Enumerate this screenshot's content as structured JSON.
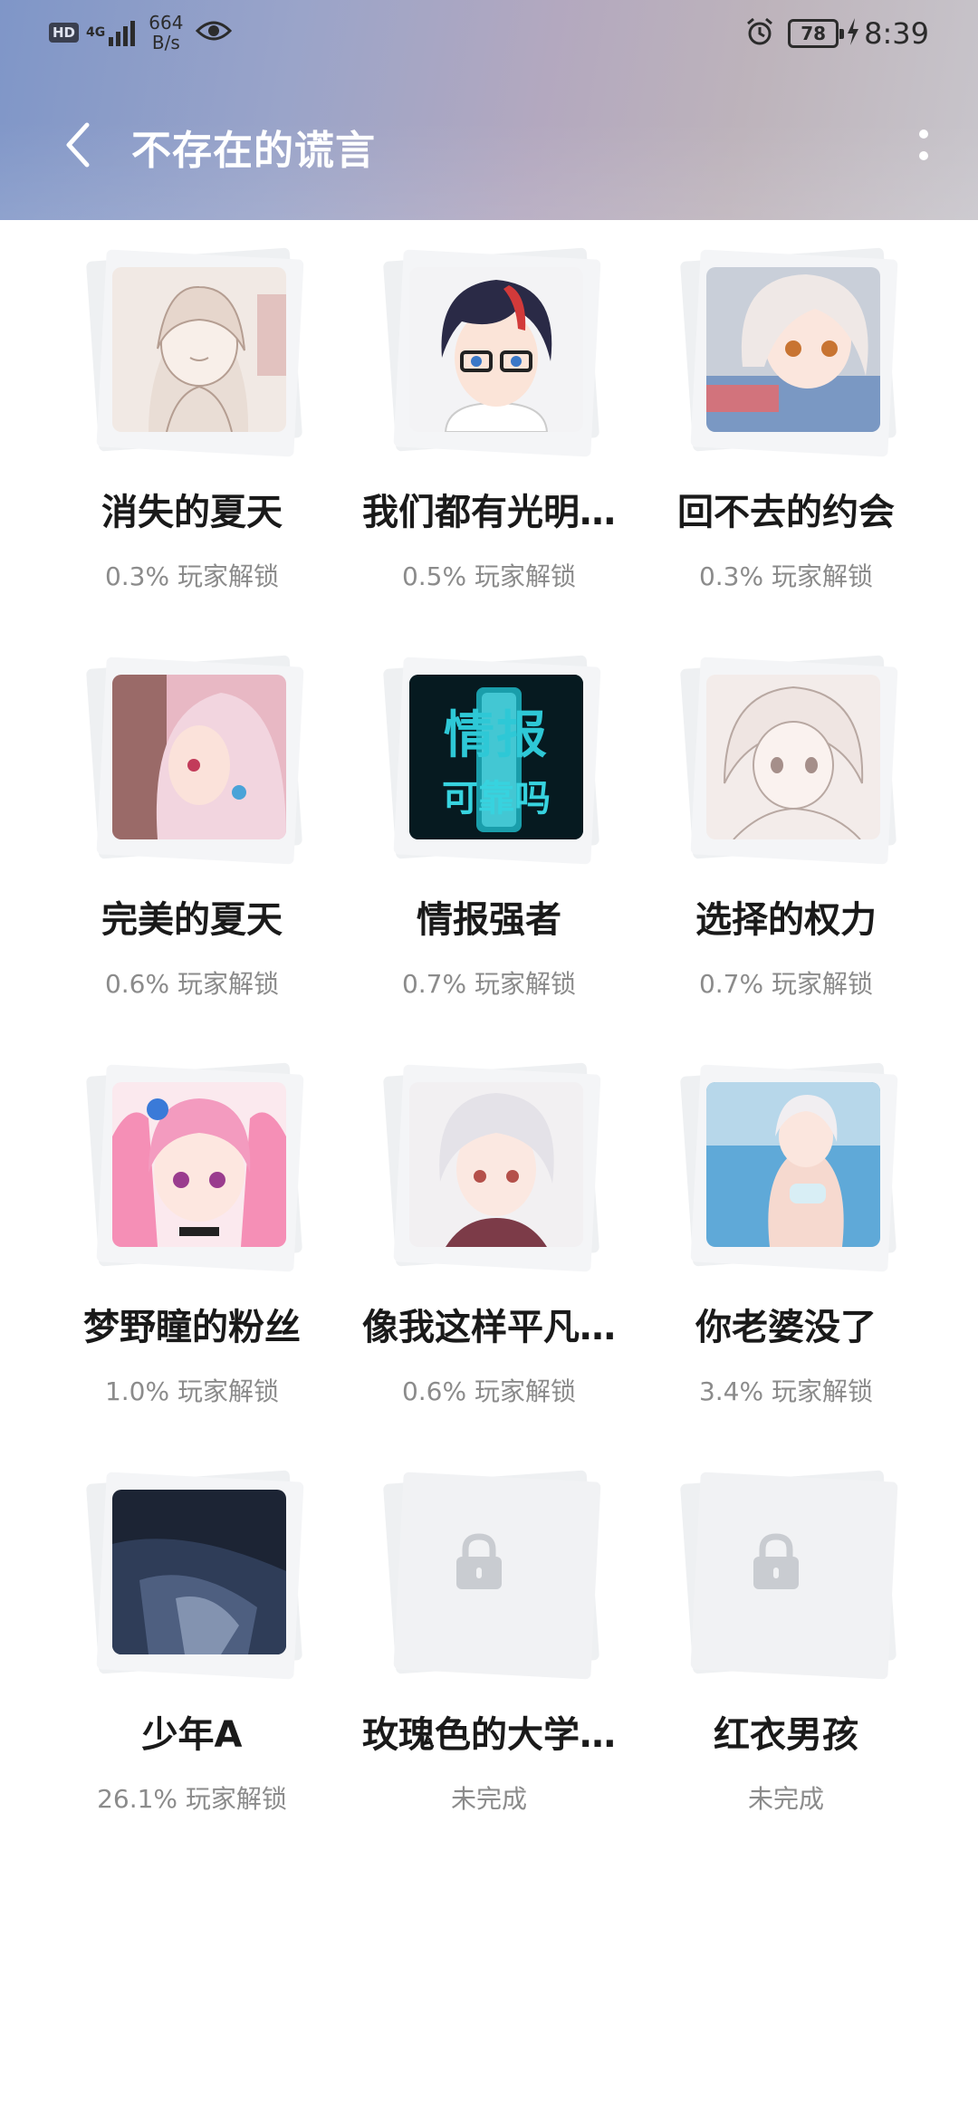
{
  "status_bar": {
    "hd": "HD",
    "network": "4G",
    "speed_value": "664",
    "speed_unit": "B/s",
    "battery": "78",
    "time": "8:39"
  },
  "header": {
    "title": "不存在的谎言"
  },
  "achievements": [
    {
      "title": "消失的夏天",
      "sub": "0.3% 玩家解锁",
      "locked": false,
      "art": "sketch-girl"
    },
    {
      "title": "我们都有光明…",
      "sub": "0.5% 玩家解锁",
      "locked": false,
      "art": "boy-glasses"
    },
    {
      "title": "回不去的约会",
      "sub": "0.3% 玩家解锁",
      "locked": false,
      "art": "white-hair-girl"
    },
    {
      "title": "完美的夏天",
      "sub": "0.6% 玩家解锁",
      "locked": false,
      "art": "pink-profile"
    },
    {
      "title": "情报强者",
      "sub": "0.7% 玩家解锁",
      "locked": false,
      "art": "info-card"
    },
    {
      "title": "选择的权力",
      "sub": "0.7% 玩家解锁",
      "locked": false,
      "art": "sketch-girl-2"
    },
    {
      "title": "梦野瞳的粉丝",
      "sub": "1.0% 玩家解锁",
      "locked": false,
      "art": "pink-twintail"
    },
    {
      "title": "像我这样平凡…",
      "sub": "0.6% 玩家解锁",
      "locked": false,
      "art": "silver-hair"
    },
    {
      "title": "你老婆没了",
      "sub": "3.4% 玩家解锁",
      "locked": false,
      "art": "pool-girl"
    },
    {
      "title": "少年A",
      "sub": "26.1% 玩家解锁",
      "locked": false,
      "art": "dark-scene"
    },
    {
      "title": "玫瑰色的大学…",
      "sub": "未完成",
      "locked": true,
      "art": "lock"
    },
    {
      "title": "红衣男孩",
      "sub": "未完成",
      "locked": true,
      "art": "lock"
    }
  ],
  "art_text": {
    "info_line1": "情报",
    "info_line2": "可靠吗"
  },
  "colors": {
    "title_text": "#1a1a1a",
    "sub_text": "#8b8b8b",
    "lock_gray": "#c9ccd1"
  }
}
